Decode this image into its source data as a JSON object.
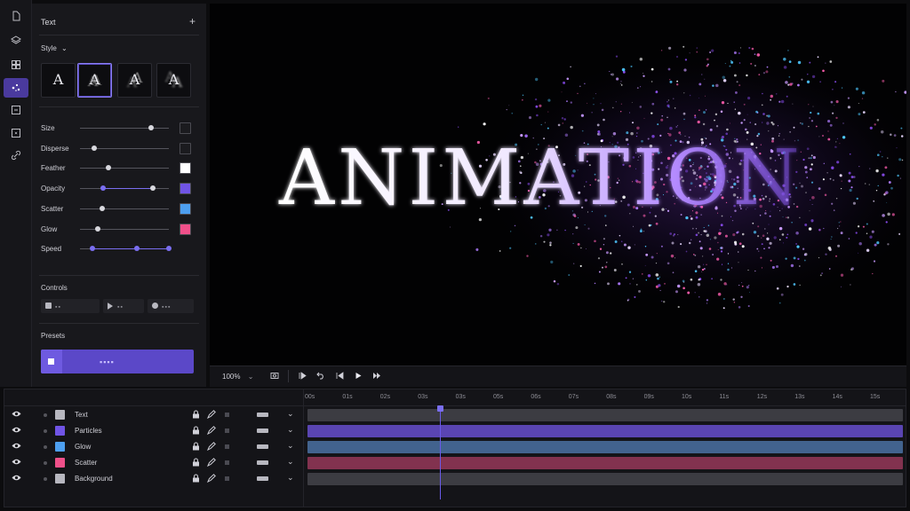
{
  "rail": {
    "icons": [
      "file-icon",
      "layers-icon",
      "grid-icon",
      "particles-icon",
      "frame-icon",
      "crop-icon",
      "link-icon"
    ],
    "active_index": 3
  },
  "panel": {
    "title": "Text",
    "add_symbol": "+",
    "style_label": "Style",
    "style_thumbs": [
      "A",
      "A",
      "A",
      "A"
    ],
    "selected_thumb": 1,
    "params": [
      {
        "label": "Size",
        "value": 0.8,
        "swatch": "#1b1b1f"
      },
      {
        "label": "Disperse",
        "value": 0.16,
        "swatch": "#1b1b1f"
      },
      {
        "label": "Feather",
        "value": 0.32,
        "swatch": "#ffffff"
      },
      {
        "label": "Opacity",
        "value": 0.82,
        "swatch": "#7054e6",
        "range_start": 0.26
      },
      {
        "label": "Scatter",
        "value": 0.25,
        "swatch": "#4d9ff0"
      },
      {
        "label": "Glow",
        "value": 0.2,
        "swatch": "#f0508a"
      },
      {
        "label": "Speed",
        "value": 1.0,
        "swatch": null,
        "range_start": 0.14,
        "mid_knob": 0.64
      }
    ],
    "controls_label": "Controls",
    "presets_label": "Presets"
  },
  "preview": {
    "text": "ANIMATION"
  },
  "transport": {
    "zoom": "100%"
  },
  "timeline": {
    "ticks": [
      "00s",
      "01s",
      "02s",
      "03s",
      "03s",
      "05s",
      "06s",
      "07s",
      "08s",
      "09s",
      "10s",
      "11s",
      "12s",
      "13s",
      "14s",
      "15s"
    ],
    "playhead_time_s": 3.5,
    "layers": [
      {
        "name": "Text",
        "color": "#b7b7bf",
        "bar": "#3c3c42"
      },
      {
        "name": "Particles",
        "color": "#7054e6",
        "bar": "#5a45b2"
      },
      {
        "name": "Glow",
        "color": "#4d9ff0",
        "bar": "#42638e"
      },
      {
        "name": "Scatter",
        "color": "#f0508a",
        "bar": "#82324f"
      },
      {
        "name": "Background",
        "color": "#b7b7bf",
        "bar": "#3c3c42"
      }
    ]
  }
}
